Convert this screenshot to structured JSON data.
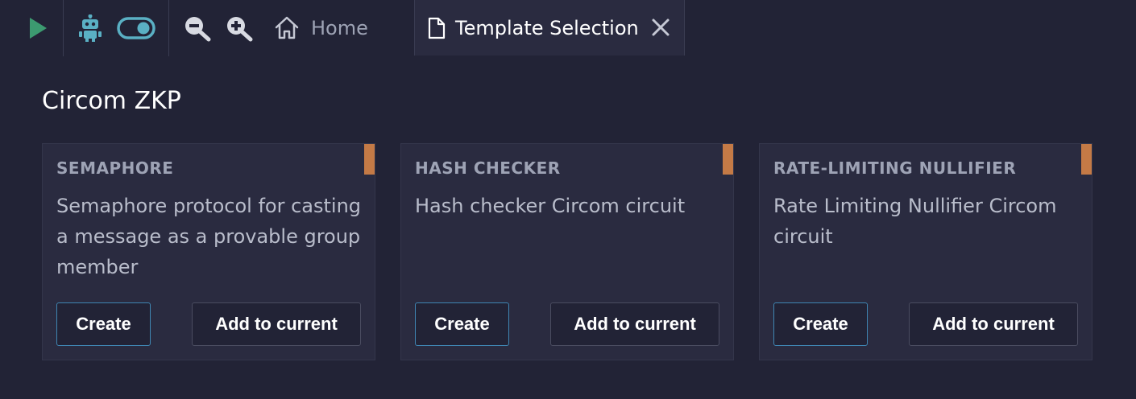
{
  "toolbar": {
    "icons": [
      "play-icon",
      "robot-icon",
      "toggle-icon",
      "zoom-out-icon",
      "zoom-in-icon"
    ],
    "home_label": "Home",
    "active_tab_label": "Template Selection"
  },
  "colors": {
    "background": "#222336",
    "card": "#2a2b40",
    "accent": "#c47a46",
    "play": "#3c9a70",
    "robot": "#5ab0c4",
    "create_border": "#3f86b3"
  },
  "section": {
    "title": "Circom ZKP"
  },
  "cards": [
    {
      "name": "SEMAPHORE",
      "description": "Semaphore protocol for casting a message as a provable group member",
      "create_label": "Create",
      "add_label": "Add to current"
    },
    {
      "name": "HASH CHECKER",
      "description": "Hash checker Circom circuit",
      "create_label": "Create",
      "add_label": "Add to current"
    },
    {
      "name": "RATE-LIMITING NULLIFIER",
      "description": "Rate Limiting Nullifier Circom circuit",
      "create_label": "Create",
      "add_label": "Add to current"
    }
  ]
}
